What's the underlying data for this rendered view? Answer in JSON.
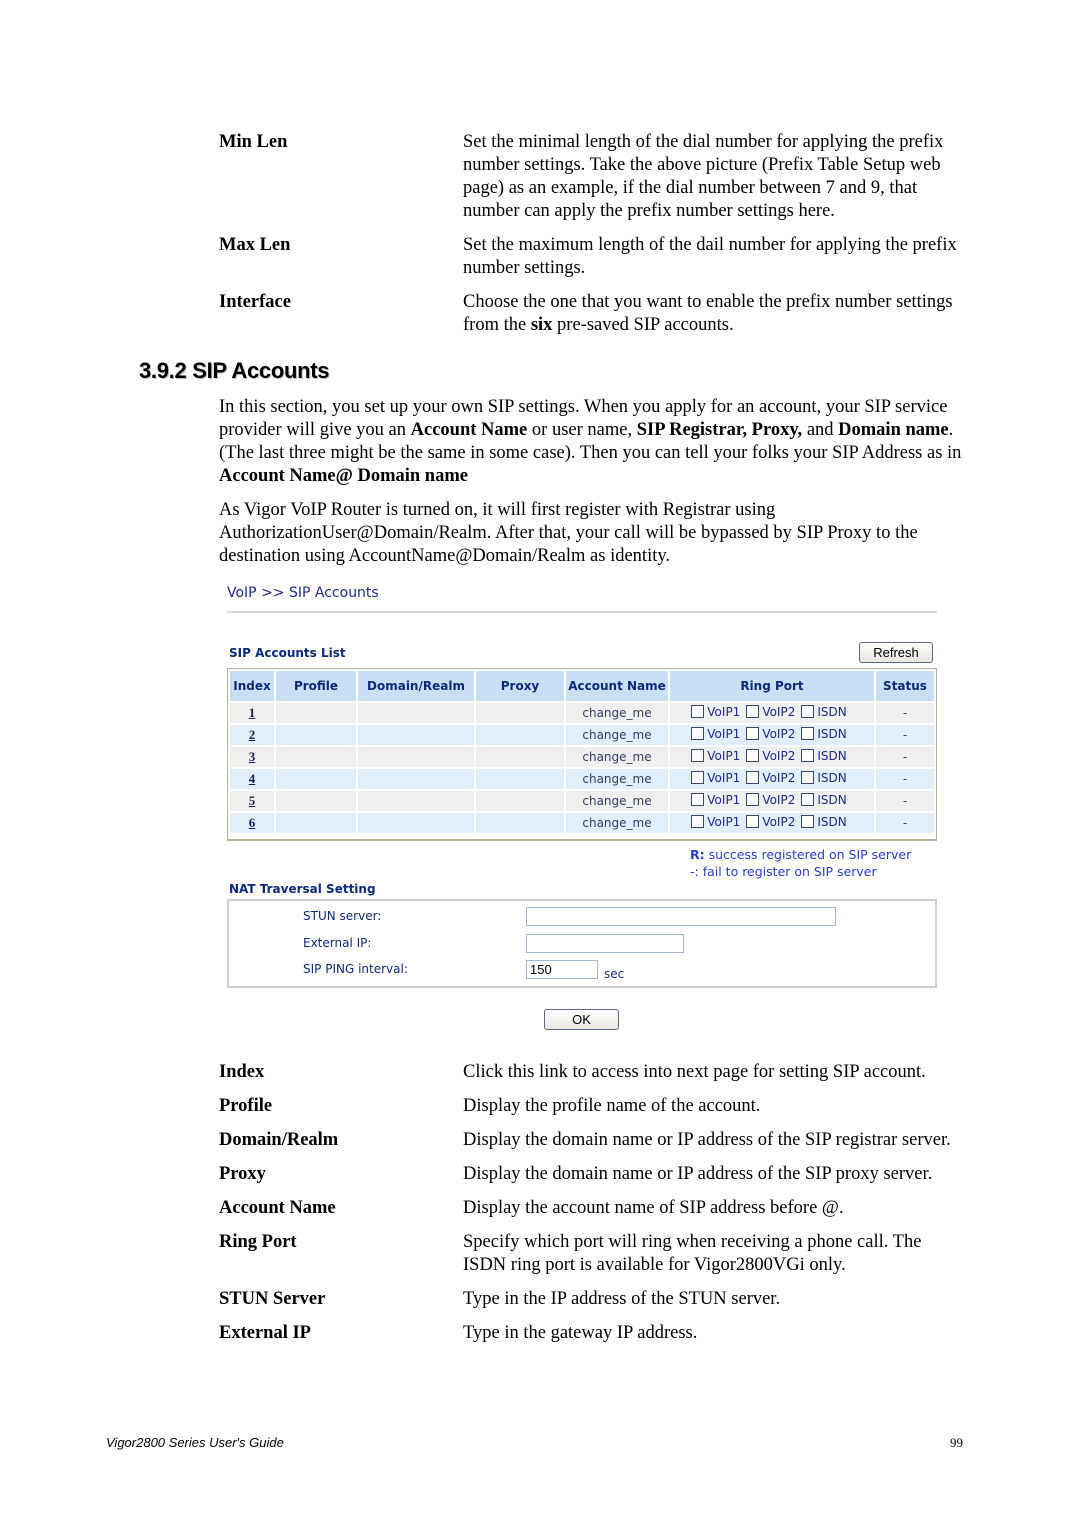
{
  "top_definitions": [
    {
      "term": "Min Len",
      "desc": "Set the minimal length of the dial number for applying the prefix number settings. Take the above picture (Prefix Table Setup web page) as an example, if the dial number between 7 and 9, that number can apply the prefix number settings here."
    },
    {
      "term": "Max Len",
      "desc": "Set the maximum length of the dail number for applying the prefix number settings."
    },
    {
      "term": "Interface",
      "desc_pre": "Choose the one that you want to enable the prefix number settings from the ",
      "desc_bold": "six",
      "desc_post": " pre-saved SIP accounts."
    }
  ],
  "section": {
    "heading": "3.9.2 SIP Accounts",
    "para1": {
      "t1": "In this section, you set up your own SIP settings. When you apply for an account, your SIP service provider will give you an ",
      "b1": "Account Name",
      "t2": " or user name, ",
      "b2": "SIP Registrar, Proxy,",
      "t3": " and ",
      "b3": "Domain name",
      "t4": ". (The last three might be the same in some case). Then you can tell your folks your SIP Address as in ",
      "b4": "Account Name@ Domain name"
    },
    "para2": "As Vigor VoIP Router is turned on, it will first register with Registrar using AuthorizationUser@Domain/Realm. After that, your call will be bypassed by SIP Proxy to the destination using AccountName@Domain/Realm as identity."
  },
  "screenshot": {
    "breadcrumb": "VoIP >> SIP Accounts",
    "list_title": "SIP Accounts List",
    "refresh_label": "Refresh",
    "columns": [
      "Index",
      "Profile",
      "Domain/Realm",
      "Proxy",
      "Account Name",
      "Ring Port",
      "Status"
    ],
    "rows": [
      {
        "index": "1",
        "profile": "",
        "domain": "",
        "proxy": "",
        "account": "change_me",
        "voip1": false,
        "voip2": false,
        "isdn": false,
        "status": "-"
      },
      {
        "index": "2",
        "profile": "",
        "domain": "",
        "proxy": "",
        "account": "change_me",
        "voip1": false,
        "voip2": false,
        "isdn": false,
        "status": "-"
      },
      {
        "index": "3",
        "profile": "",
        "domain": "",
        "proxy": "",
        "account": "change_me",
        "voip1": false,
        "voip2": false,
        "isdn": false,
        "status": "-"
      },
      {
        "index": "4",
        "profile": "",
        "domain": "",
        "proxy": "",
        "account": "change_me",
        "voip1": false,
        "voip2": false,
        "isdn": false,
        "status": "-"
      },
      {
        "index": "5",
        "profile": "",
        "domain": "",
        "proxy": "",
        "account": "change_me",
        "voip1": false,
        "voip2": false,
        "isdn": false,
        "status": "-"
      },
      {
        "index": "6",
        "profile": "",
        "domain": "",
        "proxy": "",
        "account": "change_me",
        "voip1": false,
        "voip2": false,
        "isdn": false,
        "status": "-"
      }
    ],
    "ring_port_labels": {
      "voip1": "VoIP1",
      "voip2": "VoIP2",
      "isdn": "ISDN"
    },
    "legend": {
      "r_key": "R:",
      "r_text": " success registered on SIP server",
      "dash_text": "-: fail to register on SIP server"
    },
    "nat": {
      "title": "NAT Traversal Setting",
      "stun_label": "STUN server:",
      "stun_value": "",
      "external_ip_label": "External IP:",
      "external_ip_value": "",
      "ping_label": "SIP PING interval:",
      "ping_value": "150",
      "ping_unit": "sec"
    },
    "ok_label": "OK"
  },
  "bottom_definitions": [
    {
      "term": "Index",
      "desc": "Click this link to access into next page for setting SIP account."
    },
    {
      "term": "Profile",
      "desc": "Display the profile name of the account."
    },
    {
      "term": "Domain/Realm",
      "desc": "Display the domain name or IP address of the SIP registrar server."
    },
    {
      "term": "Proxy",
      "desc": "Display the domain name or IP address of the SIP proxy server."
    },
    {
      "term": "Account Name",
      "desc": "Display the account name of SIP address before @."
    },
    {
      "term": "Ring Port",
      "desc": "Specify which port will ring when receiving a phone call. The ISDN ring port is available for Vigor2800VGi only."
    },
    {
      "term": "STUN Server",
      "desc": "Type in the IP address of the STUN server."
    },
    {
      "term": "External IP",
      "desc": "Type in the gateway IP address."
    }
  ],
  "footer": {
    "title": "Vigor2800 Series User's Guide",
    "page": "99"
  }
}
